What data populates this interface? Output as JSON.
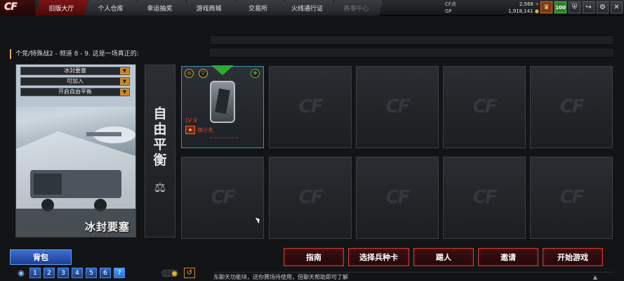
{
  "logo": {
    "text": "CF"
  },
  "nav": {
    "tabs": [
      {
        "label": "旧版大厅",
        "state": "active"
      },
      {
        "label": "个人仓库",
        "state": "normal"
      },
      {
        "label": "幸运抽奖",
        "state": "normal"
      },
      {
        "label": "游戏商城",
        "state": "normal"
      },
      {
        "label": "交易所",
        "state": "normal"
      },
      {
        "label": "火线通行证",
        "state": "normal"
      },
      {
        "label": "赛事中心",
        "state": "disabled"
      }
    ]
  },
  "currency": {
    "cf_label": "CF点",
    "cf_value": "2,568",
    "cf_plus": "+",
    "gp_label": "GP",
    "gp_value": "1,918,141",
    "gp_coin": "●"
  },
  "top_icons": {
    "rank_icon": "rank-badge-icon",
    "level_value": "100",
    "rank_glyph": "♛",
    "shield_glyph": "⛨",
    "exit_glyph": "↪",
    "gear_glyph": "⚙",
    "close_glyph": "✕"
  },
  "room": {
    "title": "个竞/特殊战2 - 频道 8 - 9. 这是一场真正的:"
  },
  "map": {
    "name": "冰封要塞",
    "dropdowns": [
      {
        "value": "冰封要塞"
      },
      {
        "value": "可加入"
      },
      {
        "value": "开启自由平衡"
      }
    ],
    "arrow": "▼"
  },
  "mode": {
    "chars": [
      "自",
      "由",
      "平",
      "衡"
    ],
    "scale_glyph": "⚖"
  },
  "player": {
    "level": "LV 9",
    "name": "萌小札",
    "badge": "★",
    "left_circle": "◎",
    "right_circle": "⊕",
    "mid_circle": "▽"
  },
  "slot_watermark": "CF",
  "actions": {
    "guide": "指南",
    "choose_card": "选择兵种卡",
    "kick": "踢人",
    "invite": "邀请",
    "start": "开始游戏"
  },
  "bag": {
    "label": "背包"
  },
  "pages": {
    "items": [
      "1",
      "2",
      "3",
      "4",
      "5",
      "6",
      "7"
    ],
    "active": "7"
  },
  "undo_glyph": "↺",
  "chat": {
    "text": "东聊天功能块，送你赛场待使用，但聊天帮助即可了解",
    "scroll_glyph": "▲"
  }
}
